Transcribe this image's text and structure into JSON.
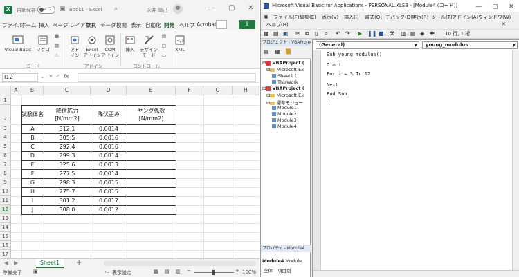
{
  "excel": {
    "title_bar": {
      "autosave_label": "自動保存",
      "autosave_state": "オフ",
      "workbook_name": "Book1 - Excel",
      "user_name": "永井 晴己"
    },
    "ribbon_tabs": [
      "ファイル",
      "ホーム",
      "挿入",
      "ページ レイアウト",
      "数式",
      "データ",
      "校閲",
      "表示",
      "自動化",
      "開発",
      "ヘルプ",
      "Acrobat"
    ],
    "active_tab": "開発",
    "ribbon": {
      "code_group": {
        "label": "コード",
        "visual_basic": "Visual Basic",
        "macro": "マクロ"
      },
      "addin_group": {
        "label": "アドイン",
        "addin": "アド\nイン",
        "excel_addin": "Excel\nアドイン",
        "com_addin": "COM\nアドイン"
      },
      "control_group": {
        "label": "コントロール",
        "insert": "挿入",
        "design_mode": "デザイン\nモード"
      },
      "xml": "XML"
    },
    "formula_bar": {
      "name_box": "I12",
      "fx": "fx",
      "value": ""
    },
    "columns": [
      "A",
      "B",
      "C",
      "D",
      "E",
      "F",
      "G",
      "H"
    ],
    "rows": [
      "1",
      "2",
      "3",
      "4",
      "5",
      "6",
      "7",
      "8",
      "9",
      "10",
      "11",
      "12",
      "13",
      "14",
      "15",
      "16",
      "17"
    ],
    "table": {
      "headers": [
        {
          "line1": "試験体名",
          "line2": ""
        },
        {
          "line1": "降伏応力",
          "line2": "[N/mm2]"
        },
        {
          "line1": "降伏歪み",
          "line2": ""
        },
        {
          "line1": "ヤング係数",
          "line2": "[N/mm2]"
        }
      ],
      "rows": [
        [
          "A",
          "312.1",
          "0.0014",
          ""
        ],
        [
          "B",
          "305.5",
          "0.0016",
          ""
        ],
        [
          "C",
          "292.4",
          "0.0016",
          ""
        ],
        [
          "D",
          "299.3",
          "0.0014",
          ""
        ],
        [
          "E",
          "325.6",
          "0.0013",
          ""
        ],
        [
          "F",
          "277.5",
          "0.0014",
          ""
        ],
        [
          "G",
          "298.3",
          "0.0015",
          ""
        ],
        [
          "H",
          "275.7",
          "0.0015",
          ""
        ],
        [
          "I",
          "301.2",
          "0.0017",
          ""
        ],
        [
          "J",
          "308.0",
          "0.0012",
          ""
        ]
      ]
    },
    "sheet_tab": "Sheet1",
    "add_sheet": "+",
    "status": {
      "ready": "準備完了",
      "display_settings": "表示設定",
      "zoom": "100%"
    }
  },
  "vbe": {
    "title": "Microsoft Visual Basic for Applications - PERSONAL.XLSB - [Module4 (コード)]",
    "menus": [
      "ファイル(F)",
      "編集(E)",
      "表示(V)",
      "挿入(I)",
      "書式(O)",
      "デバッグ(D)",
      "実行(R)",
      "ツール(T)",
      "アドイン(A)",
      "ウィンドウ(W)",
      "ヘルプ(H)"
    ],
    "cursor_position": "10 行, 1 桁",
    "project_pane": {
      "title": "プロジェクト - VBAProject",
      "tree": [
        {
          "label": "VBAProject (",
          "level": 0,
          "bold": true,
          "type": "project"
        },
        {
          "label": "Microsoft Ex",
          "level": 1,
          "bold": false,
          "type": "folder"
        },
        {
          "label": "Sheet1 (",
          "level": 2,
          "bold": false,
          "type": "module"
        },
        {
          "label": "ThisWork",
          "level": 2,
          "bold": false,
          "type": "module"
        },
        {
          "label": "VBAProject (",
          "level": 0,
          "bold": true,
          "type": "project"
        },
        {
          "label": "Microsoft Ex",
          "level": 1,
          "bold": false,
          "type": "folder"
        },
        {
          "label": "標準モジュー",
          "level": 1,
          "bold": false,
          "type": "folder"
        },
        {
          "label": "Module1",
          "level": 2,
          "bold": false,
          "type": "module"
        },
        {
          "label": "Module2",
          "level": 2,
          "bold": false,
          "type": "module"
        },
        {
          "label": "Module3",
          "level": 2,
          "bold": false,
          "type": "module"
        },
        {
          "label": "Module4",
          "level": 2,
          "bold": false,
          "type": "module"
        }
      ]
    },
    "props_pane": {
      "title": "プロパティ - Module4",
      "object": "Module4",
      "object_type": "Module",
      "tab_all": "全体",
      "tab_category": "項目別"
    },
    "code": {
      "object_dropdown": "(General)",
      "proc_dropdown": "young_modulus",
      "lines": [
        "Sub young_modulus()",
        "",
        "Dim i",
        "",
        "For i = 3 To 12",
        "",
        "Next",
        "",
        "End Sub"
      ]
    }
  }
}
